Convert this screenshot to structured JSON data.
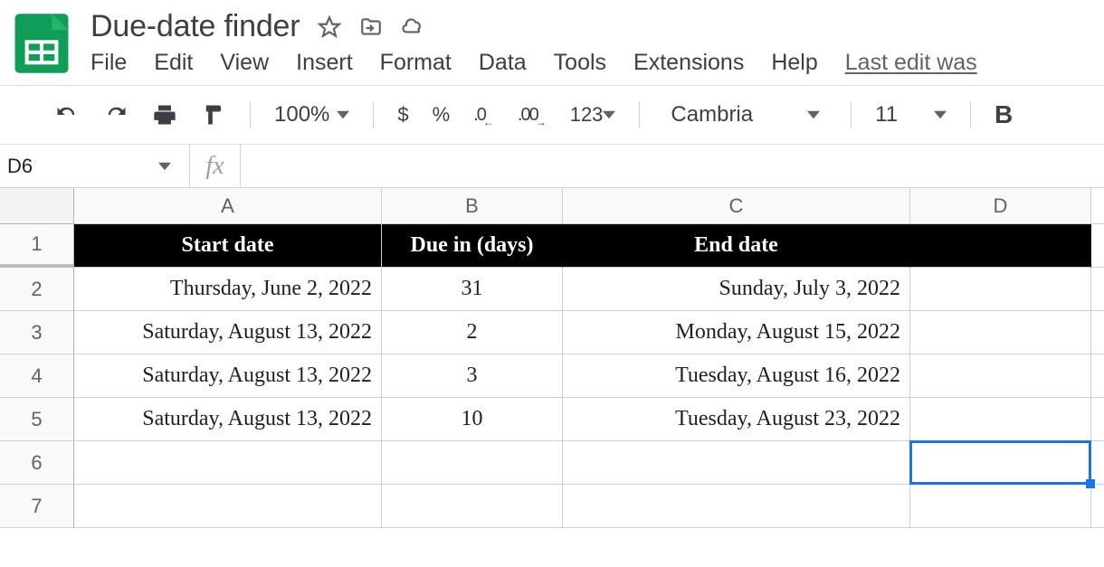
{
  "doc": {
    "title": "Due-date finder"
  },
  "menubar": {
    "file": "File",
    "edit": "Edit",
    "view": "View",
    "insert": "Insert",
    "format": "Format",
    "data": "Data",
    "tools": "Tools",
    "extensions": "Extensions",
    "help": "Help",
    "last_edit": "Last edit was"
  },
  "toolbar": {
    "zoom": "100%",
    "currency": "$",
    "percent": "%",
    "dec_less": ".0",
    "dec_more": ".00",
    "num_format": "123",
    "font": "Cambria",
    "font_size": "11",
    "bold": "B"
  },
  "namebox": {
    "cell_ref": "D6",
    "fx": "fx",
    "formula": ""
  },
  "columns": [
    "A",
    "B",
    "C",
    "D"
  ],
  "row_numbers": [
    "1",
    "2",
    "3",
    "4",
    "5",
    "6",
    "7"
  ],
  "table": {
    "headers": [
      "Start date",
      "Due in (days)",
      "End date",
      ""
    ],
    "rows": [
      {
        "a": "Thursday, June 2, 2022",
        "b": "31",
        "c": "Sunday, July 3, 2022",
        "d": ""
      },
      {
        "a": "Saturday, August 13, 2022",
        "b": "2",
        "c": "Monday, August 15, 2022",
        "d": ""
      },
      {
        "a": "Saturday, August 13, 2022",
        "b": "3",
        "c": "Tuesday, August 16, 2022",
        "d": ""
      },
      {
        "a": "Saturday, August 13, 2022",
        "b": "10",
        "c": "Tuesday, August 23, 2022",
        "d": ""
      }
    ]
  },
  "selection": {
    "cell": "D6"
  }
}
